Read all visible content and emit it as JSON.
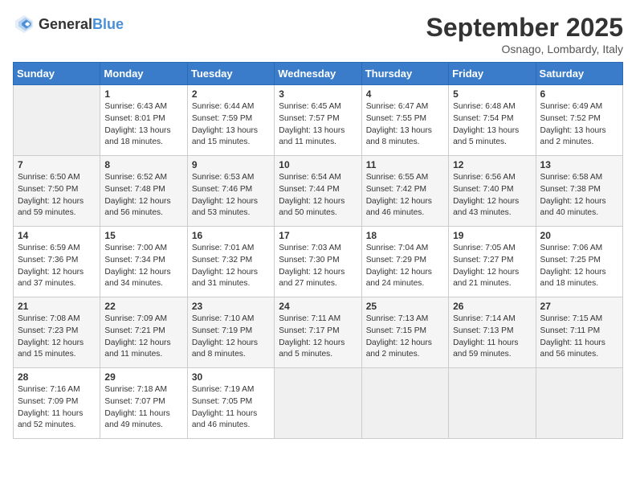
{
  "header": {
    "logo_general": "General",
    "logo_blue": "Blue",
    "title": "September 2025",
    "subtitle": "Osnago, Lombardy, Italy"
  },
  "days_of_week": [
    "Sunday",
    "Monday",
    "Tuesday",
    "Wednesday",
    "Thursday",
    "Friday",
    "Saturday"
  ],
  "weeks": [
    [
      {
        "day": "",
        "content": ""
      },
      {
        "day": "1",
        "content": "Sunrise: 6:43 AM\nSunset: 8:01 PM\nDaylight: 13 hours\nand 18 minutes."
      },
      {
        "day": "2",
        "content": "Sunrise: 6:44 AM\nSunset: 7:59 PM\nDaylight: 13 hours\nand 15 minutes."
      },
      {
        "day": "3",
        "content": "Sunrise: 6:45 AM\nSunset: 7:57 PM\nDaylight: 13 hours\nand 11 minutes."
      },
      {
        "day": "4",
        "content": "Sunrise: 6:47 AM\nSunset: 7:55 PM\nDaylight: 13 hours\nand 8 minutes."
      },
      {
        "day": "5",
        "content": "Sunrise: 6:48 AM\nSunset: 7:54 PM\nDaylight: 13 hours\nand 5 minutes."
      },
      {
        "day": "6",
        "content": "Sunrise: 6:49 AM\nSunset: 7:52 PM\nDaylight: 13 hours\nand 2 minutes."
      }
    ],
    [
      {
        "day": "7",
        "content": "Sunrise: 6:50 AM\nSunset: 7:50 PM\nDaylight: 12 hours\nand 59 minutes."
      },
      {
        "day": "8",
        "content": "Sunrise: 6:52 AM\nSunset: 7:48 PM\nDaylight: 12 hours\nand 56 minutes."
      },
      {
        "day": "9",
        "content": "Sunrise: 6:53 AM\nSunset: 7:46 PM\nDaylight: 12 hours\nand 53 minutes."
      },
      {
        "day": "10",
        "content": "Sunrise: 6:54 AM\nSunset: 7:44 PM\nDaylight: 12 hours\nand 50 minutes."
      },
      {
        "day": "11",
        "content": "Sunrise: 6:55 AM\nSunset: 7:42 PM\nDaylight: 12 hours\nand 46 minutes."
      },
      {
        "day": "12",
        "content": "Sunrise: 6:56 AM\nSunset: 7:40 PM\nDaylight: 12 hours\nand 43 minutes."
      },
      {
        "day": "13",
        "content": "Sunrise: 6:58 AM\nSunset: 7:38 PM\nDaylight: 12 hours\nand 40 minutes."
      }
    ],
    [
      {
        "day": "14",
        "content": "Sunrise: 6:59 AM\nSunset: 7:36 PM\nDaylight: 12 hours\nand 37 minutes."
      },
      {
        "day": "15",
        "content": "Sunrise: 7:00 AM\nSunset: 7:34 PM\nDaylight: 12 hours\nand 34 minutes."
      },
      {
        "day": "16",
        "content": "Sunrise: 7:01 AM\nSunset: 7:32 PM\nDaylight: 12 hours\nand 31 minutes."
      },
      {
        "day": "17",
        "content": "Sunrise: 7:03 AM\nSunset: 7:30 PM\nDaylight: 12 hours\nand 27 minutes."
      },
      {
        "day": "18",
        "content": "Sunrise: 7:04 AM\nSunset: 7:29 PM\nDaylight: 12 hours\nand 24 minutes."
      },
      {
        "day": "19",
        "content": "Sunrise: 7:05 AM\nSunset: 7:27 PM\nDaylight: 12 hours\nand 21 minutes."
      },
      {
        "day": "20",
        "content": "Sunrise: 7:06 AM\nSunset: 7:25 PM\nDaylight: 12 hours\nand 18 minutes."
      }
    ],
    [
      {
        "day": "21",
        "content": "Sunrise: 7:08 AM\nSunset: 7:23 PM\nDaylight: 12 hours\nand 15 minutes."
      },
      {
        "day": "22",
        "content": "Sunrise: 7:09 AM\nSunset: 7:21 PM\nDaylight: 12 hours\nand 11 minutes."
      },
      {
        "day": "23",
        "content": "Sunrise: 7:10 AM\nSunset: 7:19 PM\nDaylight: 12 hours\nand 8 minutes."
      },
      {
        "day": "24",
        "content": "Sunrise: 7:11 AM\nSunset: 7:17 PM\nDaylight: 12 hours\nand 5 minutes."
      },
      {
        "day": "25",
        "content": "Sunrise: 7:13 AM\nSunset: 7:15 PM\nDaylight: 12 hours\nand 2 minutes."
      },
      {
        "day": "26",
        "content": "Sunrise: 7:14 AM\nSunset: 7:13 PM\nDaylight: 11 hours\nand 59 minutes."
      },
      {
        "day": "27",
        "content": "Sunrise: 7:15 AM\nSunset: 7:11 PM\nDaylight: 11 hours\nand 56 minutes."
      }
    ],
    [
      {
        "day": "28",
        "content": "Sunrise: 7:16 AM\nSunset: 7:09 PM\nDaylight: 11 hours\nand 52 minutes."
      },
      {
        "day": "29",
        "content": "Sunrise: 7:18 AM\nSunset: 7:07 PM\nDaylight: 11 hours\nand 49 minutes."
      },
      {
        "day": "30",
        "content": "Sunrise: 7:19 AM\nSunset: 7:05 PM\nDaylight: 11 hours\nand 46 minutes."
      },
      {
        "day": "",
        "content": ""
      },
      {
        "day": "",
        "content": ""
      },
      {
        "day": "",
        "content": ""
      },
      {
        "day": "",
        "content": ""
      }
    ]
  ]
}
